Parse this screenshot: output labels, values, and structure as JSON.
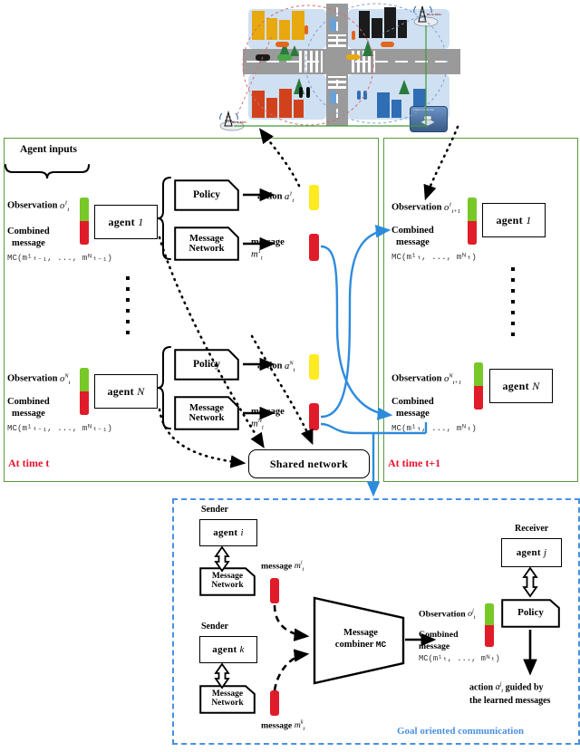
{
  "figure": {
    "type": "architecture-diagram",
    "domain": "multi-agent-reinforcement-learning-communication"
  },
  "top_scene": {
    "name": "smart-city-scenario",
    "tower_left_label": "BS & MTC",
    "tower_right_label": "BS & MTC",
    "central_controller_label": "Central Controller"
  },
  "left_panel": {
    "time_label": "At time t",
    "agent_inputs_label": "Agent inputs",
    "rows": [
      {
        "observation_label": "Observation",
        "observation_sym_base": "o",
        "observation_sym_sup": "1",
        "observation_sym_sub": "t",
        "combined_label_line1": "Combined",
        "combined_label_line2": "message",
        "combined_formula": "MC(m¹ₜ₋₁, ..., mᴺₜ₋₁)",
        "agent_label": "agent",
        "agent_index": "1",
        "policy_label": "Policy",
        "message_network_line1": "Message",
        "message_network_line2": "Network",
        "action_label": "action",
        "action_sym_base": "a",
        "action_sym_sup": "1",
        "action_sym_sub": "t",
        "message_label": "message",
        "message_sym_base": "m",
        "message_sym_sup": "1",
        "message_sym_sub": "t"
      },
      {
        "observation_label": "Observation",
        "observation_sym_base": "o",
        "observation_sym_sup": "N",
        "observation_sym_sub": "t",
        "combined_label_line1": "Combined",
        "combined_label_line2": "message",
        "combined_formula": "MC(m¹ₜ₋₁, ..., mᴺₜ₋₁)",
        "agent_label": "agent",
        "agent_index": "N",
        "policy_label": "Policy",
        "message_network_line1": "Message",
        "message_network_line2": "Network",
        "action_label": "action",
        "action_sym_base": "a",
        "action_sym_sup": "N",
        "action_sym_sub": "t",
        "message_label": "message",
        "message_sym_base": "m",
        "message_sym_sup": "N",
        "message_sym_sub": "t"
      }
    ],
    "shared_network_label": "Shared network"
  },
  "right_panel": {
    "time_label": "At time t+1",
    "rows": [
      {
        "observation_label": "Observation",
        "observation_sym_base": "o",
        "observation_sym_sup": "1",
        "observation_sym_sub": "t+1",
        "combined_label_line1": "Combined",
        "combined_label_line2": "message",
        "combined_formula": "MC(m¹ₜ, ..., mᴺₜ)",
        "agent_label": "agent",
        "agent_index": "1"
      },
      {
        "observation_label": "Observation",
        "observation_sym_base": "o",
        "observation_sym_sup": "N",
        "observation_sym_sub": "t+1",
        "combined_label_line1": "Combined",
        "combined_label_line2": "message",
        "combined_formula": "MC(m¹ₜ, ..., mᴺₜ)",
        "agent_label": "agent",
        "agent_index": "N"
      }
    ]
  },
  "bottom_panel": {
    "title": "Goal oriented communication",
    "senders": [
      {
        "role_label": "Sender",
        "agent_label": "agent",
        "agent_index": "i",
        "message_network_line1": "Message",
        "message_network_line2": "Network",
        "message_label": "message",
        "message_sym_base": "m",
        "message_sym_sup": "i",
        "message_sym_sub": "t"
      },
      {
        "role_label": "Sender",
        "agent_label": "agent",
        "agent_index": "k",
        "message_network_line1": "Message",
        "message_network_line2": "Network",
        "message_label": "message",
        "message_sym_base": "m",
        "message_sym_sup": "k",
        "message_sym_sub": "t"
      }
    ],
    "combiner": {
      "line1": "Message",
      "line2": "combiner",
      "mc": "MC"
    },
    "receiver": {
      "role_label": "Receiver",
      "agent_label": "agent",
      "agent_index": "j",
      "policy_label": "Policy",
      "observation_label": "Observation",
      "observation_sym_base": "o",
      "observation_sym_sup": "j",
      "observation_sym_sub": "t",
      "combined_label_line1": "Combined",
      "combined_label_line2": "message",
      "combined_formula": "MC(m¹ₜ, ..., mᴺₜ)",
      "action_line1_a": "action",
      "action_sym_base": "a",
      "action_sym_sup": "j",
      "action_sym_sub": "t",
      "action_line1_b": "guided by",
      "action_line2": "the learned messages"
    }
  },
  "colors": {
    "panel_green": "#5a9a3c",
    "panel_blue": "#4a90e2",
    "arrow_blue": "#2d8bdd",
    "observation_green": "#78c828",
    "message_red": "#e01b2a",
    "action_yellow": "#ffeb1f",
    "time_label_red": "#e8112d"
  }
}
